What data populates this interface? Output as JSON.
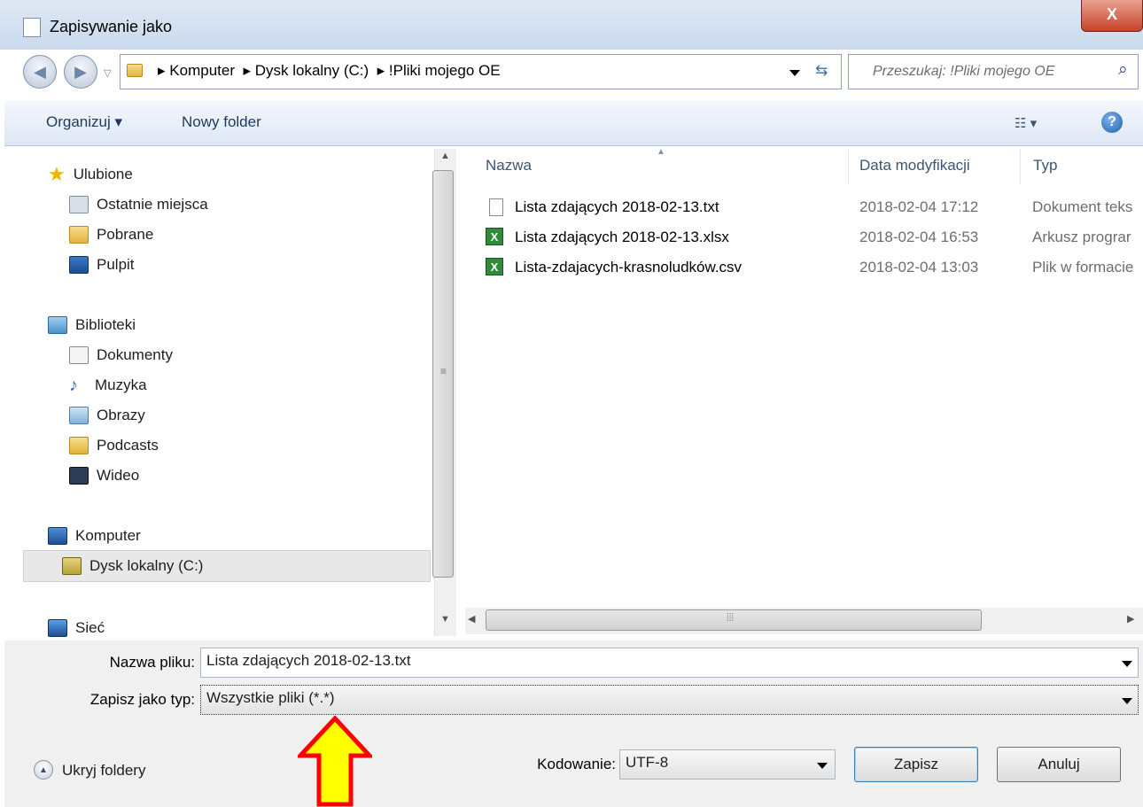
{
  "window": {
    "title": "Zapisywanie jako",
    "close_glyph": "X"
  },
  "address": {
    "crumbs": [
      "Komputer",
      "Dysk lokalny (C:)",
      "!Pliki mojego OE"
    ],
    "search_placeholder": "Przeszukaj: !Pliki mojego OE"
  },
  "toolbar": {
    "organize": "Organizuj ▾",
    "new_folder": "Nowy folder"
  },
  "nav": {
    "favorites": "Ulubione",
    "fav_items": [
      "Ostatnie miejsca",
      "Pobrane",
      "Pulpit"
    ],
    "libraries": "Biblioteki",
    "lib_items": [
      "Dokumenty",
      "Muzyka",
      "Obrazy",
      "Podcasts",
      "Wideo"
    ],
    "computer": "Komputer",
    "computer_items": [
      "Dysk lokalny (C:)"
    ],
    "network": "Sieć"
  },
  "columns": {
    "name": "Nazwa",
    "date": "Data modyfikacji",
    "type": "Typ"
  },
  "files": [
    {
      "name": "Lista zdających 2018-02-13.txt",
      "date": "2018-02-04 17:12",
      "type": "Dokument teks",
      "icon": "text-file-icon"
    },
    {
      "name": "Lista zdających 2018-02-13.xlsx",
      "date": "2018-02-04 16:53",
      "type": "Arkusz prograr",
      "icon": "excel-file-icon"
    },
    {
      "name": "Lista-zdajacych-krasnoludków.csv",
      "date": "2018-02-04 13:03",
      "type": "Plik w formacie",
      "icon": "excel-file-icon"
    }
  ],
  "form": {
    "filename_label": "Nazwa pliku:",
    "filename_value": "Lista zdających 2018-02-13.txt",
    "filetype_label": "Zapisz jako typ:",
    "filetype_value": "Wszystkie pliki  (*.*)",
    "encoding_label": "Kodowanie:",
    "encoding_value": "UTF-8",
    "hide_folders": "Ukryj foldery",
    "save": "Zapisz",
    "cancel": "Anuluj"
  },
  "colors": {
    "highlight_arrow_fill": "#ffff00",
    "highlight_arrow_stroke": "#ff0000"
  }
}
